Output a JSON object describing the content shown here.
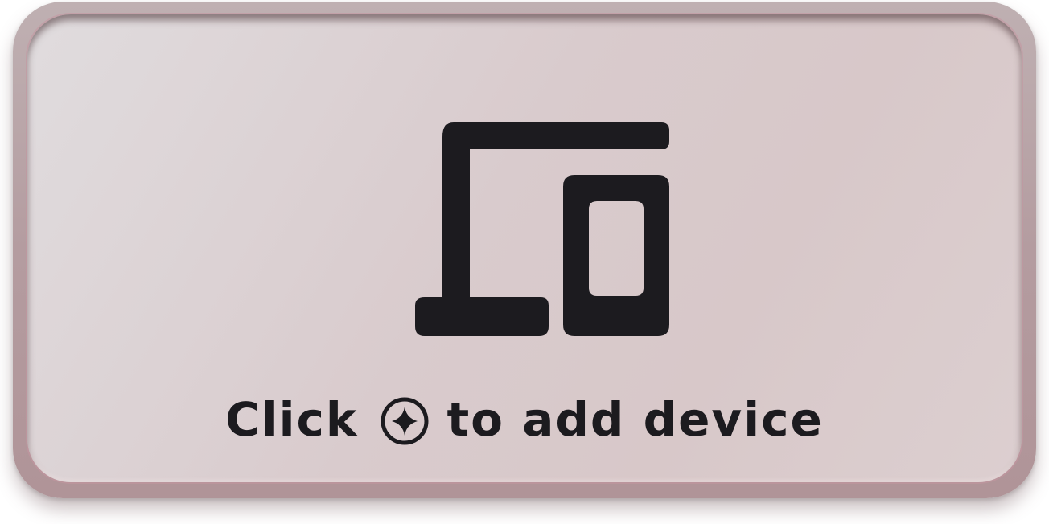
{
  "empty_state": {
    "icon": "devices-icon",
    "hint_before": "Click",
    "hint_icon": "add-circle-icon",
    "hint_after": "to add device"
  },
  "colors": {
    "foreground": "#1c1b1f",
    "card_background": "#dbcfd0",
    "frame": "#b89ea2"
  }
}
